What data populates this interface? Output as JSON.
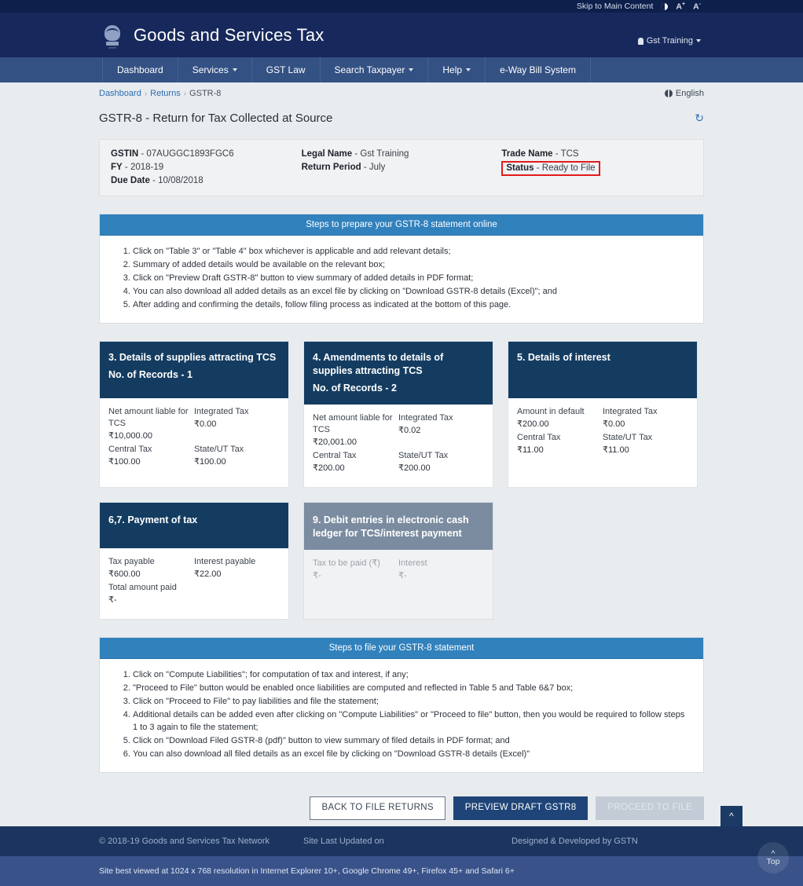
{
  "utility": {
    "skip_link": "Skip to Main Content",
    "contrast_icon": "contrast-toggle-icon",
    "font_increase": "A",
    "font_increase_sup": "+",
    "font_decrease": "A",
    "font_decrease_sup": "-"
  },
  "header": {
    "title": "Goods and Services Tax",
    "emblem_caption": "सत्यमेव जयते",
    "user": "Gst Training"
  },
  "nav": {
    "items": [
      {
        "label": "Dashboard",
        "has_caret": false
      },
      {
        "label": "Services",
        "has_caret": true
      },
      {
        "label": "GST Law",
        "has_caret": false
      },
      {
        "label": "Search Taxpayer",
        "has_caret": true
      },
      {
        "label": "Help",
        "has_caret": true
      },
      {
        "label": "e-Way Bill System",
        "has_caret": false
      }
    ]
  },
  "breadcrumb": {
    "item1": "Dashboard",
    "item2": "Returns",
    "item3": "GSTR-8"
  },
  "language": "English",
  "page_title": "GSTR-8 - Return for Tax Collected at Source",
  "taxpayer": {
    "gstin_label": "GSTIN",
    "gstin_value": "07AUGGC1893FGC6",
    "fy_label": "FY",
    "fy_value": "2018-19",
    "due_date_label": "Due Date",
    "due_date_value": "10/08/2018",
    "legal_name_label": "Legal Name",
    "legal_name_value": "Gst Training",
    "return_period_label": "Return Period",
    "return_period_value": "July",
    "trade_name_label": "Trade Name",
    "trade_name_value": "TCS",
    "status_label": "Status",
    "status_value": "Ready to File",
    "status_highlight_color": "#e21b1b"
  },
  "prepare_steps": {
    "heading": "Steps to prepare your GSTR-8 statement online",
    "items": [
      "Click on \"Table 3\" or \"Table 4\" box whichever is applicable and add relevant details;",
      "Summary of added details would be available on the relevant box;",
      "Click on \"Preview Draft GSTR-8\" button to view summary of added details in PDF format;",
      "You can also download all added details as an excel file by clicking on \"Download GSTR-8 details (Excel)\"; and",
      "After adding and confirming the details, follow filing process as indicated at the bottom of this page."
    ]
  },
  "tiles": [
    {
      "title": "3. Details of supplies attracting TCS",
      "records_label": "No. of Records - 1",
      "disabled": false,
      "cells": [
        {
          "label": "Net amount liable for TCS",
          "value": "₹10,000.00"
        },
        {
          "label": "Integrated Tax",
          "value": "₹0.00"
        },
        {
          "label": "Central Tax",
          "value": "₹100.00"
        },
        {
          "label": "State/UT Tax",
          "value": "₹100.00"
        }
      ]
    },
    {
      "title": "4. Amendments to details of supplies attracting TCS",
      "records_label": "No. of Records - 2",
      "disabled": false,
      "cells": [
        {
          "label": "Net amount liable for TCS",
          "value": "₹20,001.00"
        },
        {
          "label": "Integrated Tax",
          "value": "₹0.02"
        },
        {
          "label": "Central Tax",
          "value": "₹200.00"
        },
        {
          "label": "State/UT Tax",
          "value": "₹200.00"
        }
      ]
    },
    {
      "title": "5. Details of interest",
      "records_label": "",
      "disabled": false,
      "cells": [
        {
          "label": "Amount in default",
          "value": "₹200.00"
        },
        {
          "label": "Integrated Tax",
          "value": "₹0.00"
        },
        {
          "label": "Central Tax",
          "value": "₹11.00"
        },
        {
          "label": "State/UT Tax",
          "value": "₹11.00"
        }
      ]
    },
    {
      "title": "6,7. Payment of tax",
      "records_label": "",
      "disabled": false,
      "cells": [
        {
          "label": "Tax payable",
          "value": "₹600.00"
        },
        {
          "label": "Interest payable",
          "value": "₹22.00"
        },
        {
          "label": "Total amount paid",
          "value": "₹-"
        },
        {
          "label": "",
          "value": ""
        }
      ]
    },
    {
      "title": "9. Debit entries in electronic cash ledger for TCS/interest payment",
      "records_label": "",
      "disabled": true,
      "cells": [
        {
          "label": "Tax to be paid (₹)",
          "value": "₹-"
        },
        {
          "label": "Interest",
          "value": "₹-"
        }
      ]
    }
  ],
  "file_steps": {
    "heading": "Steps to file your GSTR-8 statement",
    "items": [
      "Click on \"Compute Liabilities\"; for computation of tax and interest, if any;",
      "\"Proceed to File\" button would be enabled once liabilities are computed and reflected in Table 5 and Table 6&7 box;",
      "Click on \"Proceed to File\" to pay liabilities and file the statement;",
      "Additional details can be added even after clicking on \"Compute Liabilities\" or \"Proceed to file\" button, then you would be required to follow steps 1 to 3 again to file the statement;",
      "Click on \"Download Filed GSTR-8 (pdf)\" button to view summary of filed details in PDF format; and",
      "You can also download all filed details as an excel file by clicking on \"Download GSTR-8 details (Excel)\""
    ]
  },
  "actions": {
    "back": "BACK TO FILE RETURNS",
    "preview": "PREVIEW DRAFT GSTR8",
    "proceed": "PROCEED TO FILE"
  },
  "footer": {
    "copyright": "© 2018-19 Goods and Services Tax Network",
    "last_updated": "Site Last Updated on",
    "designed_by": "Designed & Developed by GSTN",
    "best_viewed": "Site best viewed at 1024 x 768 resolution in Internet Explorer 10+, Google Chrome 49+, Firefox 45+ and Safari 6+",
    "top_label": "Top"
  },
  "colors": {
    "brand_navy": "#17295c",
    "nav_blue": "#345183",
    "panel_blue": "#3181bd",
    "tile_navy": "#143c61",
    "tile_disabled": "#7b8ca0",
    "accent_red": "#e21b1b"
  }
}
